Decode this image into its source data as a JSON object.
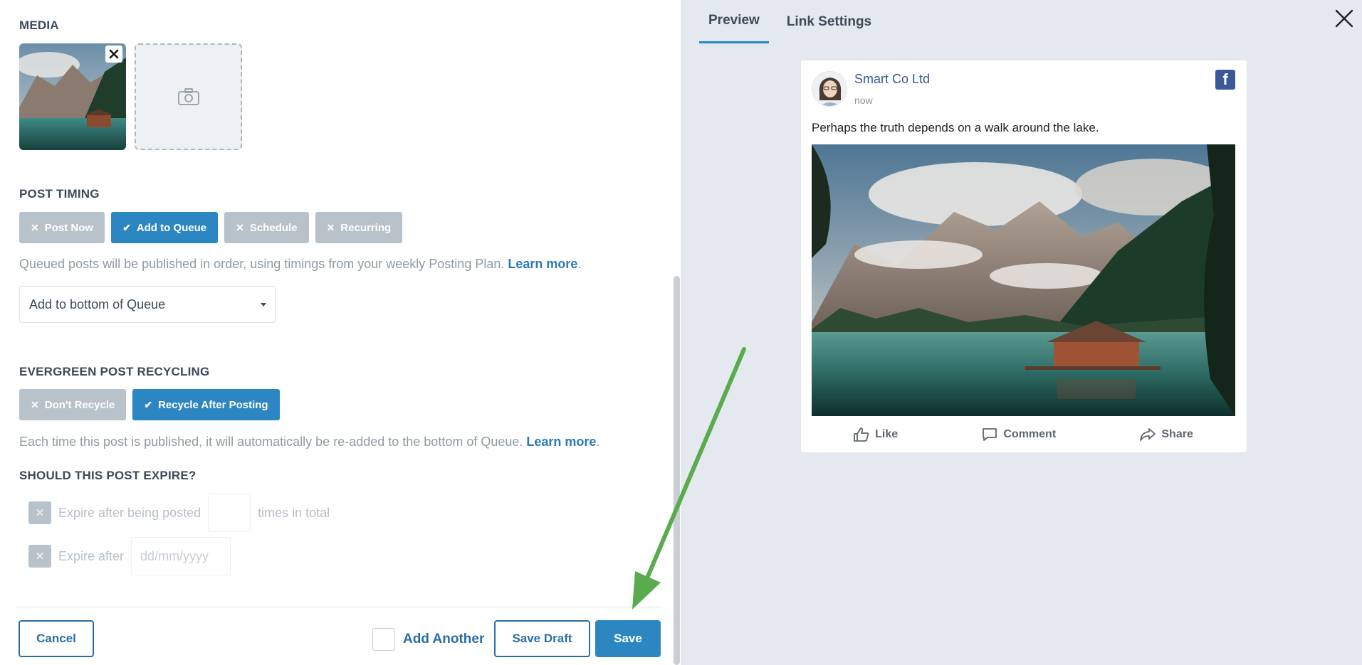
{
  "media": {
    "title": "MEDIA"
  },
  "timing": {
    "title": "POST TIMING",
    "options": [
      {
        "label": "Post Now",
        "mark": "✕"
      },
      {
        "label": "Add to Queue",
        "mark": "✔"
      },
      {
        "label": "Schedule",
        "mark": "✕"
      },
      {
        "label": "Recurring",
        "mark": "✕"
      }
    ],
    "help_text": "Queued posts will be published in order, using timings from your weekly Posting Plan.",
    "help_link": "Learn more",
    "queue_select": "Add to bottom of Queue"
  },
  "recycling": {
    "title": "EVERGREEN POST RECYCLING",
    "options": [
      {
        "label": "Don't Recycle",
        "mark": "✕"
      },
      {
        "label": "Recycle After Posting",
        "mark": "✔"
      }
    ],
    "help_text": "Each time this post is published, it will automatically be re-added to the bottom of Queue.",
    "help_link": "Learn more"
  },
  "expire": {
    "title": "SHOULD THIS POST EXPIRE?",
    "after_posted_label": "Expire after being posted",
    "times_suffix": "times in total",
    "after_date_label": "Expire after",
    "date_placeholder": "dd/mm/yyyy",
    "mark": "✕"
  },
  "footer": {
    "cancel": "Cancel",
    "add_another": "Add Another",
    "save_draft": "Save Draft",
    "save": "Save"
  },
  "preview": {
    "tabs": [
      "Preview",
      "Link Settings"
    ],
    "page_name": "Smart Co Ltd",
    "time": "now",
    "text": "Perhaps the truth depends on a walk around the lake.",
    "network_icon": "f",
    "actions": {
      "like": "Like",
      "comment": "Comment",
      "share": "Share"
    }
  },
  "colors": {
    "accent": "#2b86c1",
    "off": "#b8c2cb",
    "link": "#2b7ab8",
    "arrow": "#5aaa4e",
    "panel": "#e3e9ef"
  },
  "icons": [
    "close-icon",
    "camera-icon",
    "check-icon",
    "chevron-down-icon",
    "facebook-icon",
    "like-icon",
    "comment-icon",
    "share-icon",
    "arrow-icon"
  ]
}
